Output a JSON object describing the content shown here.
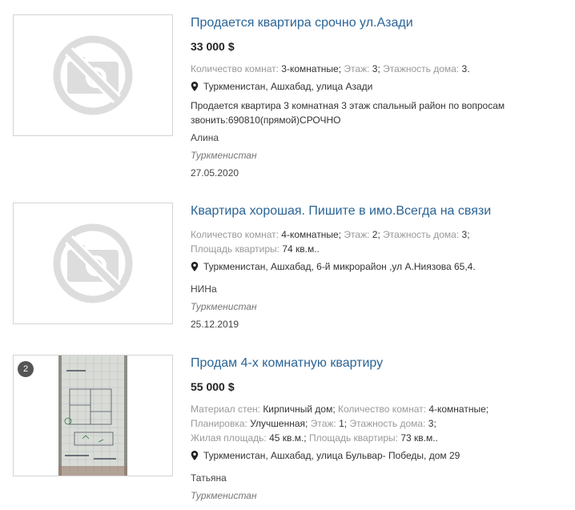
{
  "listings": [
    {
      "title": "Продается квартира срочно ул.Азади",
      "price": "33 000",
      "currency": "$",
      "params": [
        {
          "key": "Количество комнат:",
          "value": "3-комнатные;"
        },
        {
          "key": "Этаж:",
          "value": "3;"
        },
        {
          "key": "Этажность дома:",
          "value": "3."
        }
      ],
      "location": "Туркменистан, Ашхабад, улица Азади",
      "description": "Продается квартира 3 комнатная 3 этаж спальный район по вопросам звонить:690810(прямой)СРОЧНО",
      "author": "Алина",
      "region": "Туркменистан",
      "date": "27.05.2020",
      "image": "no-photo-icon"
    },
    {
      "title": "Квартира хорошая. Пишите в имо.Всегда на связи",
      "params": [
        {
          "key": "Количество комнат:",
          "value": "4-комнатные;"
        },
        {
          "key": "Этаж:",
          "value": "2;"
        },
        {
          "key": "Этажность дома:",
          "value": "3;"
        },
        {
          "key": "Площадь квартиры:",
          "value": "74 кв.м.."
        }
      ],
      "location": "Туркменистан, Ашхабад, 6-й микрорайон ,ул А.Ниязова 65,4.",
      "author": "НИНа",
      "region": "Туркменистан",
      "date": "25.12.2019",
      "image": "no-photo-icon"
    },
    {
      "title": "Продам 4-х комнатную квартиру",
      "price": "55 000",
      "currency": "$",
      "photo_count": "2",
      "params": [
        {
          "key": "Материал стен:",
          "value": "Кирпичный дом;"
        },
        {
          "key": "Количество комнат:",
          "value": "4-комнатные;"
        },
        {
          "key": "Планировка:",
          "value": "Улучшенная;"
        },
        {
          "key": "Этаж:",
          "value": "1;"
        },
        {
          "key": "Этажность дома:",
          "value": "3;"
        },
        {
          "key": "Жилая площадь:",
          "value": "45 кв.м.;"
        },
        {
          "key": "Площадь квартиры:",
          "value": "73 кв.м.."
        }
      ],
      "location": "Туркменистан, Ашхабад, улица Бульвар- Победы, дом 29",
      "author": "Татьяна",
      "region": "Туркменистан",
      "image": "floor-plan-photo"
    }
  ],
  "colors": {
    "link": "#2a6496",
    "muted": "#999999",
    "border": "#d4d4d4",
    "placeholder": "#dddddd"
  }
}
